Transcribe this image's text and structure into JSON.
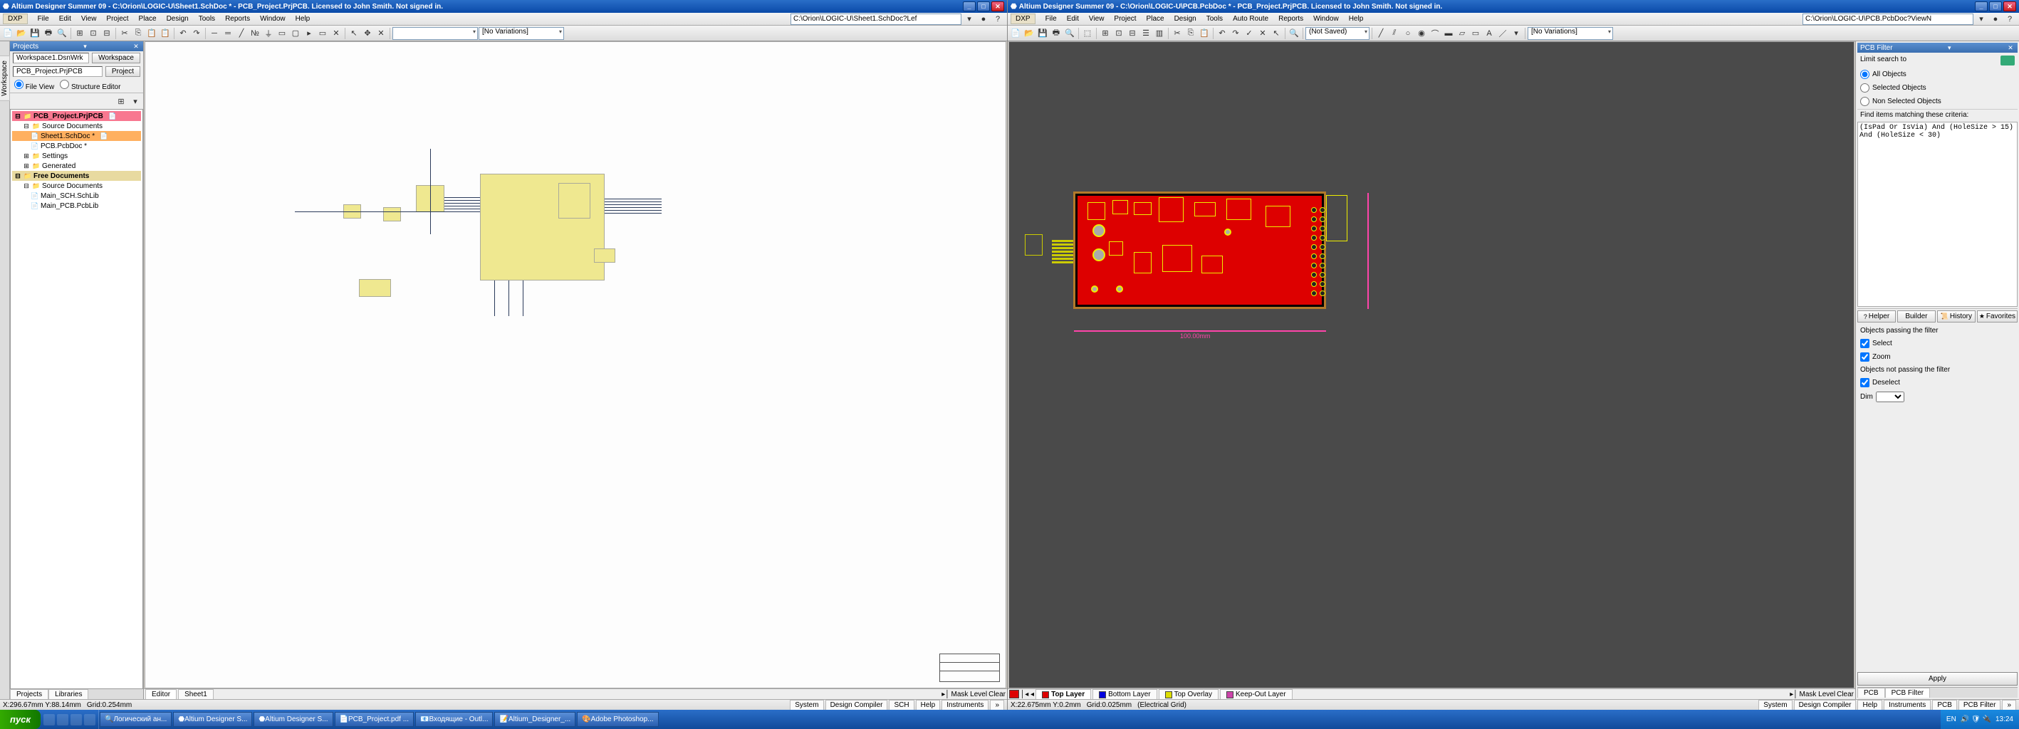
{
  "left": {
    "title": "Altium Designer Summer 09 - C:\\Orion\\LOGIC-U\\Sheet1.SchDoc * - PCB_Project.PrjPCB. Licensed to John Smith. Not signed in.",
    "menus": [
      "DXP",
      "File",
      "Edit",
      "View",
      "Project",
      "Place",
      "Design",
      "Tools",
      "Reports",
      "Window",
      "Help"
    ],
    "path": "C:\\Orion\\LOGIC-U\\Sheet1.SchDoc?Lef",
    "variations": "[No Variations]",
    "projects": {
      "title": "Projects",
      "workspace": "Workspace1.DsnWrk",
      "workspace_btn": "Workspace",
      "project": "PCB_Project.PrjPCB",
      "project_btn": "Project",
      "fileview": "File View",
      "structed": "Structure Editor",
      "tree": {
        "pcbprj": "PCB_Project.PrjPCB",
        "srcdocs": "Source Documents",
        "sheet1": "Sheet1.SchDoc *",
        "pcbdoc": "PCB.PcbDoc *",
        "settings": "Settings",
        "generated": "Generated",
        "freedocs": "Free Documents",
        "srcdocs2": "Source Documents",
        "mainsch": "Main_SCH.SchLib",
        "mainpcb": "Main_PCB.PcbLib"
      },
      "bottomtabs": [
        "Projects",
        "Libraries"
      ]
    },
    "editor_tabs": [
      "Editor",
      "Sheet1"
    ],
    "status": {
      "coord": "X:296.67mm Y:88.14mm",
      "grid": "Grid:0.254mm"
    },
    "sbtns": [
      "System",
      "Design Compiler",
      "SCH",
      "Help",
      "Instruments"
    ],
    "masklevel": "Mask Level",
    "clear": "Clear"
  },
  "right": {
    "title": "Altium Designer Summer 09 - C:\\Orion\\LOGIC-U\\PCB.PcbDoc * - PCB_Project.PrjPCB. Licensed to John Smith. Not signed in.",
    "menus": [
      "DXP",
      "File",
      "Edit",
      "View",
      "Project",
      "Place",
      "Design",
      "Tools",
      "Auto Route",
      "Reports",
      "Window",
      "Help"
    ],
    "path": "C:\\Orion\\LOGIC-U\\PCB.PcbDoc?ViewN",
    "variations": "[No Variations]",
    "notsaved": "(Not Saved)",
    "layers": [
      {
        "name": "Top Layer",
        "color": "#d00"
      },
      {
        "name": "Bottom Layer",
        "color": "#00d"
      },
      {
        "name": "Top Overlay",
        "color": "#dd0"
      },
      {
        "name": "Keep-Out Layer",
        "color": "#c4a"
      }
    ],
    "dim_w": "100.00mm",
    "status": {
      "coord": "X:22.675mm Y:0.2mm",
      "grid": "Grid:0.025mm",
      "type": "(Electrical Grid)"
    },
    "sbtns": [
      "System",
      "Design Compiler",
      "Help",
      "Instruments",
      "PCB",
      "PCB Filter"
    ],
    "masklevel": "Mask Level",
    "clear": "Clear",
    "filter": {
      "title": "PCB Filter",
      "limit": "Limit search to",
      "r1": "All Objects",
      "r2": "Selected Objects",
      "r3": "Non Selected Objects",
      "finditems": "Find items matching these criteria:",
      "expr": "(IsPad Or IsVia) And (HoleSize > 15) And (HoleSize < 30)",
      "helper": "Helper",
      "builder": "Builder",
      "history": "History",
      "fav": "Favorites",
      "passing": "Objects passing the filter",
      "select": "Select",
      "zoom": "Zoom",
      "notpassing": "Objects not passing the filter",
      "deselect": "Deselect",
      "dim": "Dim",
      "apply": "Apply",
      "bottomtabs": [
        "PCB",
        "PCB Filter"
      ]
    }
  },
  "taskbar": {
    "start": "пуск",
    "tasks": [
      "Логический ан...",
      "Altium Designer S...",
      "Altium Designer S...",
      "PCB_Project.pdf ...",
      "Входящие - Outl...",
      "Altium_Designer_...",
      "Adobe Photoshop..."
    ],
    "lang": "EN",
    "time": "13:24"
  }
}
